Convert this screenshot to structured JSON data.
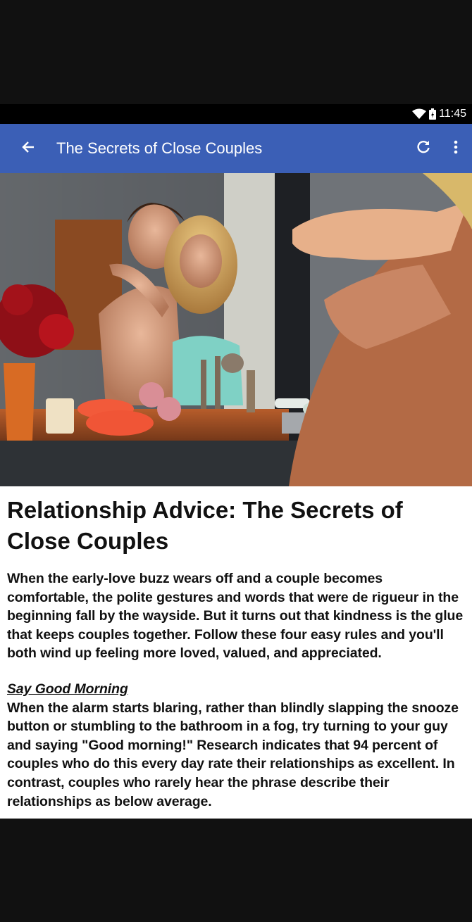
{
  "status_bar": {
    "time": "11:45"
  },
  "app_bar": {
    "title": "The Secrets of Close Couples"
  },
  "icons": {
    "back": "back-arrow-icon",
    "refresh": "refresh-icon",
    "menu": "more-vert-icon"
  },
  "colors": {
    "app_bar": "#3b5fb6",
    "status_bar": "#000000",
    "background": "#111111"
  },
  "article": {
    "title": "Relationship Advice: The Secrets of Close Couples",
    "intro": "When the early-love buzz wears off and a couple becomes comfortable, the polite gestures and words that were de rigueur in the beginning fall by the wayside. But it turns out that kindness is the glue that keeps couples together. Follow these four easy rules and you'll both wind up feeling more loved, valued, and appreciated.",
    "section_title": "Say Good Morning",
    "section_body": "When the alarm starts blaring, rather than blindly slapping the snooze button or stumbling to the bathroom in a fog, try turning to your guy and saying \"Good morning!\" Research indicates that 94 percent of couples who do this every day rate their relationships as excellent. In contrast, couples who rarely hear the phrase describe their relationships as below average."
  }
}
